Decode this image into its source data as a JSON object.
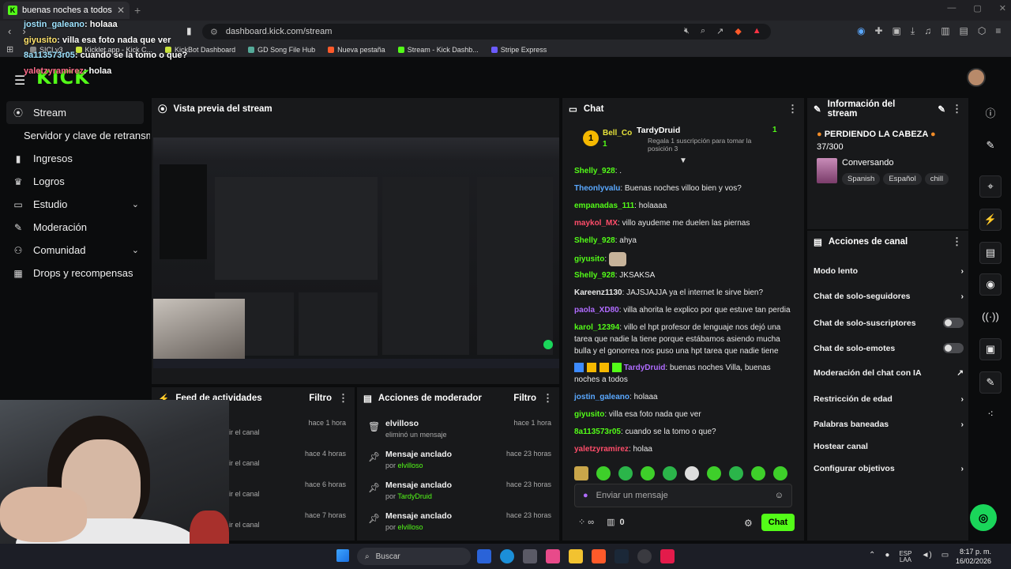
{
  "browser": {
    "tab_title": "buenas noches a todos",
    "url": "dashboard.kick.com/stream",
    "bookmarks": [
      "SICI v3",
      "Kicklet.app - Kick C...",
      "KickBot Dashboard",
      "GD Song File Hub",
      "Nueva pestaña",
      "Stream - Kick Dashb...",
      "Stripe Express"
    ]
  },
  "overlay_chat": [
    {
      "user": "jostin_galeano",
      "text": ": holaaa"
    },
    {
      "user": "giyusito",
      "text": ": villa esa foto nada que ver"
    },
    {
      "user": "8a113573r05",
      "text": ": cuando se la tomo o que?"
    },
    {
      "user": "yaletzyramirez",
      "text": ": holaa"
    }
  ],
  "header": {
    "logo": "KICK"
  },
  "sidebar": {
    "items": [
      {
        "label": "Stream",
        "icon": "stream-icon"
      },
      {
        "label": "Servidor y clave de retransmisión",
        "icon": ""
      },
      {
        "label": "Ingresos",
        "icon": "chart-icon"
      },
      {
        "label": "Logros",
        "icon": "trophy-icon"
      },
      {
        "label": "Estudio",
        "icon": "studio-icon"
      },
      {
        "label": "Moderación",
        "icon": "wrench-icon"
      },
      {
        "label": "Comunidad",
        "icon": "people-icon"
      },
      {
        "label": "Drops y recompensas",
        "icon": "drops-icon"
      }
    ]
  },
  "preview": {
    "title": "Vista previa del stream"
  },
  "feed": {
    "title": "Feed de actividades",
    "filter": "Filtro",
    "rows": [
      {
        "text": "ir el canal",
        "time": "hace 1 hora"
      },
      {
        "text": "ir el canal",
        "time": "hace 4 horas"
      },
      {
        "text": "ir el canal",
        "time": "hace 6 horas"
      },
      {
        "text": "ir el canal",
        "time": "hace 7 horas"
      }
    ]
  },
  "mod_actions": {
    "title": "Acciones de moderador",
    "filter": "Filtro",
    "rows": [
      {
        "title": "elvilloso",
        "sub": "eliminó un mensaje",
        "by": "",
        "time": "hace 1 hora"
      },
      {
        "title": "Mensaje anclado",
        "sub": "por ",
        "by": "elvilloso",
        "time": "hace 23 horas"
      },
      {
        "title": "Mensaje anclado",
        "sub": "por ",
        "by": "TardyDruid",
        "time": "hace 23 horas"
      },
      {
        "title": "Mensaje anclado",
        "sub": "por ",
        "by": "elvilloso",
        "time": "hace 23 horas"
      }
    ]
  },
  "chat": {
    "title": "Chat",
    "pinned": {
      "left_user": "Bell_Co",
      "left_count": "1",
      "right_user": "TardyDruid",
      "right_count": "1",
      "right_text": "Regala 1 suscripción para tomar la posición 3"
    },
    "messages": [
      {
        "user": "Shelly_928",
        "color": "#53fc18",
        "text": " ."
      },
      {
        "user": "Theonlyvalu",
        "color": "#5aa8ff",
        "text": " Buenas noches villoo bien y vos?"
      },
      {
        "user": "empanadas_111",
        "color": "#53fc18",
        "text": " holaaaa"
      },
      {
        "user": "maykol_MX",
        "color": "#ff4d6a",
        "text": " villo ayudeme me duelen las piernas"
      },
      {
        "user": "Shelly_928",
        "color": "#53fc18",
        "text": " ahya"
      },
      {
        "user": "giyusito",
        "color": "#53fc18",
        "text": ""
      },
      {
        "user": "Shelly_928",
        "color": "#53fc18",
        "text": " JKSAKSA"
      },
      {
        "user": "Kareenz1130",
        "color": "#e8e8e8",
        "text": " JAJSJAJJA ya el internet le sirve bien?"
      },
      {
        "user": "paola_XD80",
        "color": "#b06cff",
        "text": " villa ahorita le explico por que estuve tan perdia"
      },
      {
        "user": "karol_12394",
        "color": "#53fc18",
        "text": " villo el hpt profesor de lenguaje nos dejó una tarea que nadie la tiene porque estábamos asiendo mucha bulla y el gonorrea nos puso una hpt tarea que nadie tiene"
      },
      {
        "user": "TardyDruid",
        "color": "#b06cff",
        "text": " buenas noches Villa, buenas noches a todos"
      },
      {
        "user": "jostin_galeano",
        "color": "#5aa8ff",
        "text": " holaaa"
      },
      {
        "user": "giyusito",
        "color": "#53fc18",
        "text": " villa esa foto nada que ver"
      },
      {
        "user": "8a113573r05",
        "color": "#53fc18",
        "text": " cuando se la tomo o que?"
      },
      {
        "user": "yaletzyramirez",
        "color": "#ff4d6a",
        "text": " holaa"
      }
    ],
    "input_placeholder": "Enviar un mensaje",
    "send_label": "Chat",
    "points": "0"
  },
  "info": {
    "title": "Información del stream",
    "stream_title": "PERDIENDO LA CABEZA",
    "goal": "37/300",
    "category": "Conversando",
    "tags": [
      "Spanish",
      "Español",
      "chill"
    ]
  },
  "channel_actions": {
    "title": "Acciones de canal",
    "items": [
      {
        "label": "Modo lento",
        "control": "chevron"
      },
      {
        "label": "Chat de solo-seguidores",
        "control": "chevron"
      },
      {
        "label": "Chat de solo-suscriptores",
        "control": "toggle"
      },
      {
        "label": "Chat de solo-emotes",
        "control": "toggle"
      },
      {
        "label": "Moderación del chat con IA",
        "control": "external"
      },
      {
        "label": "Restricción de edad",
        "control": "chevron"
      },
      {
        "label": "Palabras baneadas",
        "control": "chevron"
      },
      {
        "label": "Hostear canal",
        "control": "none"
      },
      {
        "label": "Configurar objetivos",
        "control": "chevron"
      }
    ]
  },
  "taskbar": {
    "search": "Buscar",
    "lang": "ESP",
    "lang2": "LAA",
    "time": "8:17 p. m.",
    "date": "16/02/2026"
  },
  "colors": {
    "accent": "#53fc18",
    "panel": "#18191b",
    "bg": "#0b0c0d"
  }
}
